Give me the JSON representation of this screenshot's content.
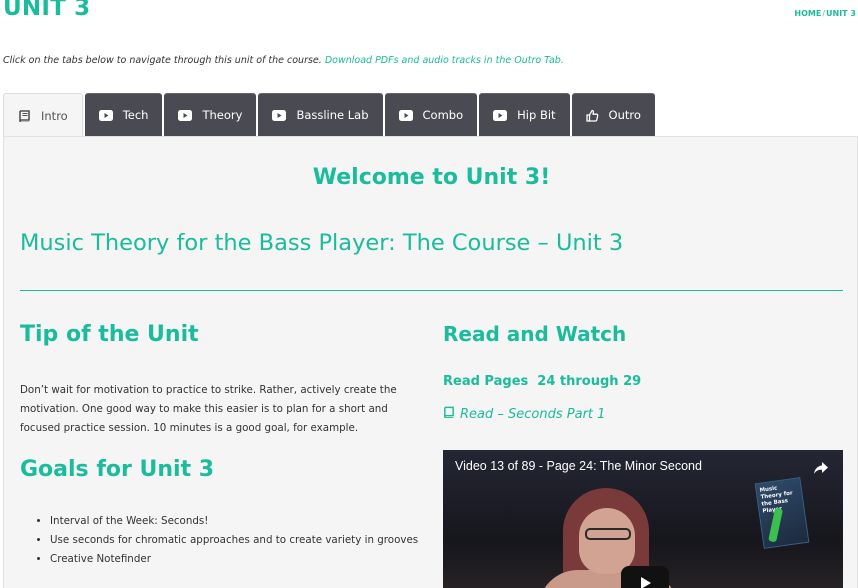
{
  "header": {
    "title": "UNIT 3",
    "breadcrumb": {
      "home": "HOME",
      "separator": "/",
      "current": "UNIT 3"
    }
  },
  "intro": {
    "text": "Click on the tabs below to navigate through this unit of the course.",
    "link": "Download PDFs and audio tracks in the Outro Tab."
  },
  "tabs": [
    {
      "label": "Intro",
      "icon": "book-icon",
      "active": true
    },
    {
      "label": "Tech",
      "icon": "play-icon"
    },
    {
      "label": "Theory",
      "icon": "play-icon"
    },
    {
      "label": "Bassline Lab",
      "icon": "play-icon"
    },
    {
      "label": "Combo",
      "icon": "play-icon"
    },
    {
      "label": "Hip Bit",
      "icon": "play-icon"
    },
    {
      "label": "Outro",
      "icon": "thumbs-up-icon"
    }
  ],
  "main": {
    "welcome": "Welcome to Unit 3!",
    "course_title": "Music Theory for the Bass Player: The Course – Unit 3",
    "tip": {
      "title": "Tip of the Unit",
      "text": "Don’t wait for motivation to practice to strike. Rather, actively create the motivation. One good way to make this easier is to plan for a short and focused practice session. 10 minutes is a good goal, for example."
    },
    "goals": {
      "title": "Goals for Unit 3",
      "items": [
        "Interval of the Week: Seconds!",
        "Use seconds for chromatic approaches and to create variety in grooves",
        "Creative Notefinder"
      ]
    },
    "read_watch": {
      "title": "Read and Watch",
      "pages": "Read Pages  24 through 29",
      "link": "Read – Seconds Part 1"
    },
    "video": {
      "title": "Video 13 of 89 - Page 24: The Minor Second",
      "book_text": "Music Theory for the Bass Player"
    }
  },
  "colors": {
    "accent": "#1abc9c",
    "tab_bg": "#4a4a52",
    "panel_bg": "#f5f5f5"
  }
}
